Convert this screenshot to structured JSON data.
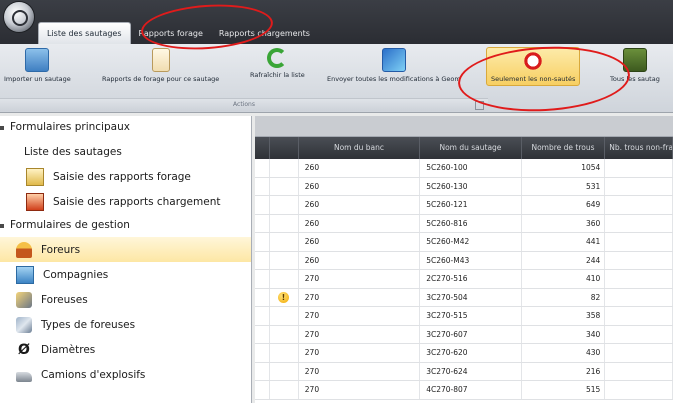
{
  "tabs": [
    {
      "label": "Liste des sautages",
      "active": true
    },
    {
      "label": "Rapports forage",
      "active": false
    },
    {
      "label": "Rapports chargements",
      "active": false
    }
  ],
  "ribbon": {
    "buttons": {
      "import": "Importer un sautage",
      "reports": "Rapports de forage pour ce sautage",
      "refresh": "Rafraîchir la liste",
      "send": "Envoyer toutes les modifications à Geom",
      "unsauted": "Seulement les non-sautés",
      "all": "Tous les sautag"
    },
    "group_label": "Actions"
  },
  "sidebar": {
    "section_main": "Formulaires principaux",
    "main_items": [
      "Liste des sautages",
      "Saisie des rapports forage",
      "Saisie des rapports chargement"
    ],
    "section_management": "Formulaires de gestion",
    "management_items": [
      "Foreurs",
      "Compagnies",
      "Foreuses",
      "Types de foreuses",
      "Diamètres",
      "Camions d'explosifs"
    ],
    "selected": "Foreurs"
  },
  "grid": {
    "columns": [
      "Nom du banc",
      "Nom du sautage",
      "Nombre de trous",
      "Nb. trous non-fran"
    ],
    "rows": [
      {
        "banc": "260",
        "sautage": "5C260-100",
        "trous": "1054",
        "warn": false
      },
      {
        "banc": "260",
        "sautage": "5C260-130",
        "trous": "531",
        "warn": false
      },
      {
        "banc": "260",
        "sautage": "5C260-121",
        "trous": "649",
        "warn": false
      },
      {
        "banc": "260",
        "sautage": "5C260-816",
        "trous": "360",
        "warn": false
      },
      {
        "banc": "260",
        "sautage": "5C260-M42",
        "trous": "441",
        "warn": false
      },
      {
        "banc": "260",
        "sautage": "5C260-M43",
        "trous": "244",
        "warn": false
      },
      {
        "banc": "270",
        "sautage": "2C270-516",
        "trous": "410",
        "warn": false
      },
      {
        "banc": "270",
        "sautage": "3C270-504",
        "trous": "82",
        "warn": true
      },
      {
        "banc": "270",
        "sautage": "3C270-515",
        "trous": "358",
        "warn": false
      },
      {
        "banc": "270",
        "sautage": "3C270-607",
        "trous": "340",
        "warn": false
      },
      {
        "banc": "270",
        "sautage": "3C270-620",
        "trous": "430",
        "warn": false
      },
      {
        "banc": "270",
        "sautage": "3C270-624",
        "trous": "216",
        "warn": false
      },
      {
        "banc": "270",
        "sautage": "4C270-807",
        "trous": "515",
        "warn": false
      }
    ]
  },
  "colors": {
    "accent_highlight": "#f7cf62",
    "selection": "#fde7a4",
    "annotation_red": "#e01b1b",
    "header_dark": "#2f3237"
  }
}
